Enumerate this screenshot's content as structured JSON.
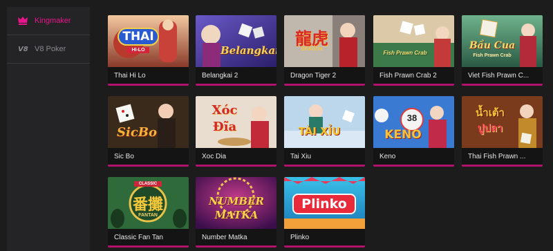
{
  "sidebar": {
    "items": [
      {
        "label": "Kingmaker",
        "icon": "kingmaker-icon",
        "active": true
      },
      {
        "label": "V8 Poker",
        "icon": "v8-logo-icon",
        "active": false
      }
    ]
  },
  "games": [
    {
      "title": "Thai Hi Lo",
      "art_text": "THAI",
      "art_sub": "HI-LO"
    },
    {
      "title": "Belangkai 2",
      "art_text": "Belangkai"
    },
    {
      "title": "Dragon Tiger 2",
      "art_text": "龍虎",
      "art_sub": "DRAGON"
    },
    {
      "title": "Fish Prawn Crab 2",
      "art_text": "Fish Prawn Crab"
    },
    {
      "title": "Viet Fish Prawn C...",
      "art_text": "Bầu Cua",
      "art_sub": "Fish Prawn Crab"
    },
    {
      "title": "Sic Bo",
      "art_text": "SicBo"
    },
    {
      "title": "Xoc Dia",
      "art_text": "Xóc",
      "art_sub": "Đĩa"
    },
    {
      "title": "Tai Xiu",
      "art_text": "TÀI XỈU"
    },
    {
      "title": "Keno",
      "art_text": "KENO",
      "art_sub": "38"
    },
    {
      "title": "Thai Fish Prawn ...",
      "art_text": "น้ำเต้า",
      "art_sub": "ปูปลา"
    },
    {
      "title": "Classic Fan Tan",
      "art_text": "番攤",
      "art_sub": "CLASSIC",
      "art_sub2": "FANTAN"
    },
    {
      "title": "Number Matka",
      "art_text": "NUMBER",
      "art_sub": "MATKA"
    },
    {
      "title": "Plinko",
      "art_text": "Plinko"
    }
  ],
  "colors": {
    "accent": "#e9168b",
    "accent_bar": "#b2126c",
    "background": "#1c1c1d",
    "sidebar": "#242426"
  }
}
